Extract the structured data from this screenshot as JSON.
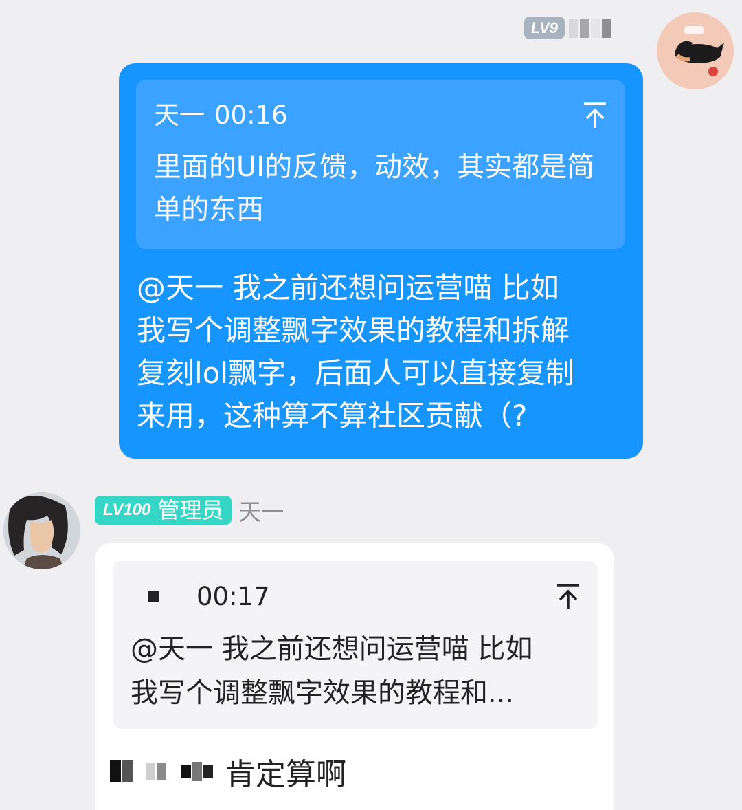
{
  "self": {
    "level_badge": "LV9",
    "avatar_icon": "shiba-dog-avatar"
  },
  "outgoing": {
    "quote": {
      "author": "天一",
      "time": "00:16",
      "text": "里面的UI的反馈，动效，其实都是简单的东西"
    },
    "body": "@天一 我之前还想问运营喵 比如\n我写个调整飘字效果的教程和拆解\n复刻lol飘字，后面人可以直接复制\n来用，这种算不算社区贡献（?"
  },
  "other": {
    "level_badge": "LV100",
    "role_badge": "管理员",
    "name": "天一",
    "avatar_icon": "swordsman-avatar"
  },
  "incoming": {
    "quote": {
      "time": "00:17",
      "text": "@天一 我之前还想问运营喵 比如\n我写个调整飘字效果的教程和..."
    },
    "reply": "肯定算啊"
  },
  "colors": {
    "bubble_out": "#1795ff",
    "quote_out": "#3ba3ff",
    "badge_admin": "#36d6c6",
    "badge_level": "#a9b3bf"
  }
}
